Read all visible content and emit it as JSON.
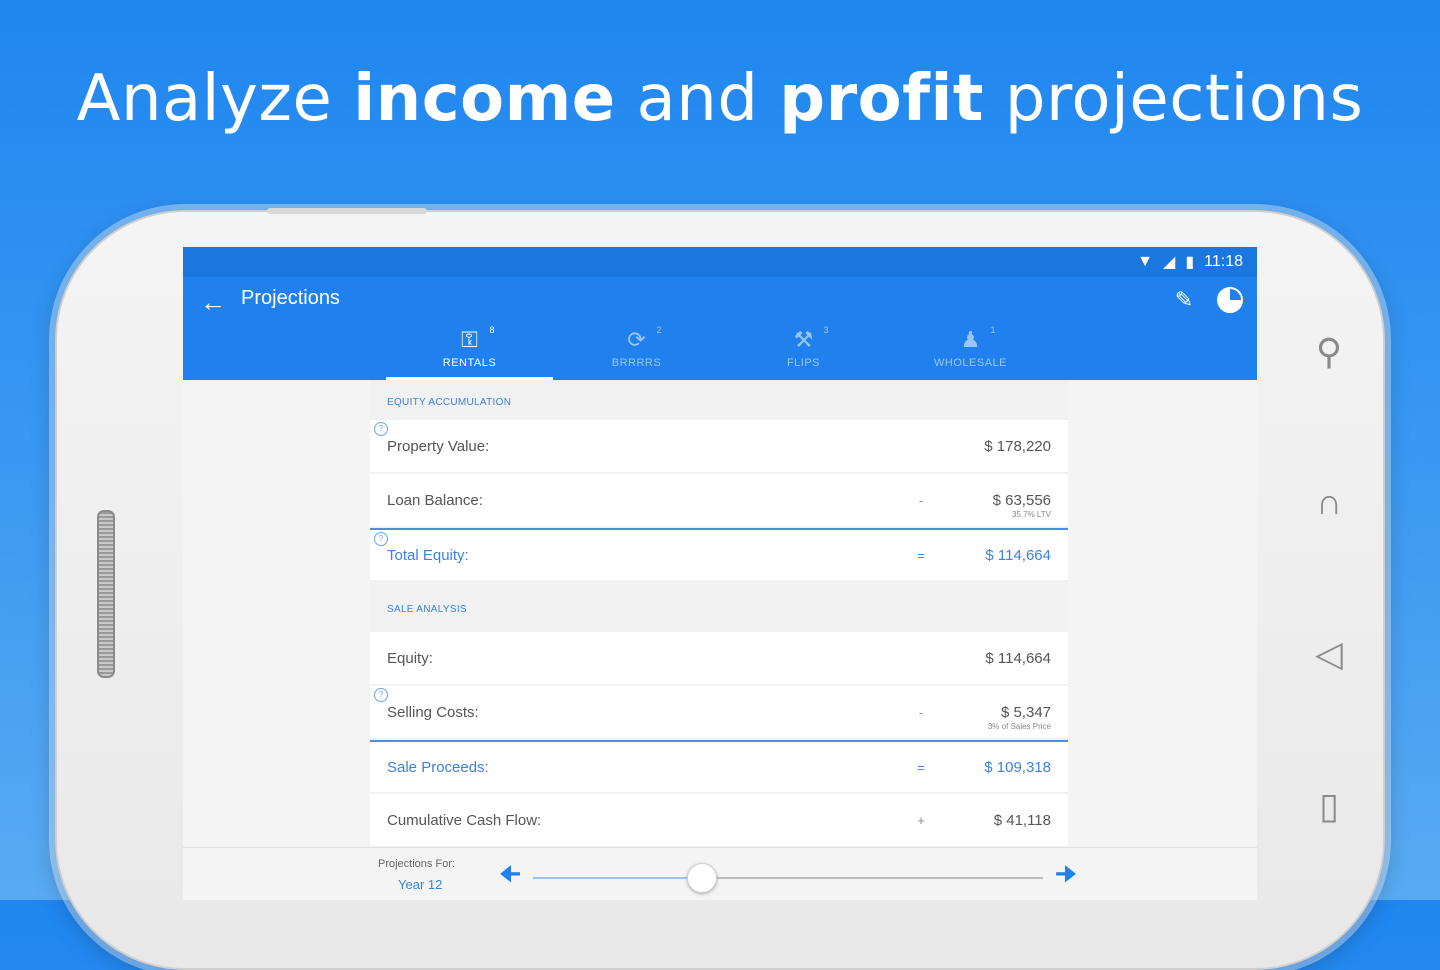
{
  "headline": {
    "part1": "Analyze ",
    "bold1": "income",
    "part2": " and ",
    "bold2": "profit",
    "part3": " projections"
  },
  "status": {
    "time": "11:18"
  },
  "appbar": {
    "title": "Projections"
  },
  "tabs": [
    {
      "label": "RENTALS",
      "count": "8",
      "icon": "key-icon",
      "active": true
    },
    {
      "label": "BRRRRS",
      "count": "2",
      "icon": "refresh-icon",
      "active": false
    },
    {
      "label": "FLIPS",
      "count": "3",
      "icon": "tools-icon",
      "active": false
    },
    {
      "label": "WHOLESALE",
      "count": "1",
      "icon": "people-icon",
      "active": false
    }
  ],
  "equity": {
    "header": "EQUITY ACCUMULATION",
    "property_value": {
      "label": "Property Value:",
      "value": "$ 178,220"
    },
    "loan_balance": {
      "label": "Loan Balance:",
      "op": "-",
      "value": "$ 63,556",
      "sub": "35.7% LTV"
    },
    "total_equity": {
      "label": "Total Equity:",
      "op": "=",
      "value": "$ 114,664"
    }
  },
  "sale": {
    "header": "SALE ANALYSIS",
    "equity": {
      "label": "Equity:",
      "value": "$ 114,664"
    },
    "selling_costs": {
      "label": "Selling Costs:",
      "op": "-",
      "value": "$ 5,347",
      "sub": "3% of Sales Price"
    },
    "sale_proceeds": {
      "label": "Sale Proceeds:",
      "op": "=",
      "value": "$ 109,318"
    },
    "cumulative_cash_flow": {
      "label": "Cumulative Cash Flow:",
      "op": "+",
      "value": "$ 41,118"
    }
  },
  "projection": {
    "label": "Projections For:",
    "year": "Year 12",
    "slider_fraction": 0.33
  },
  "colors": {
    "primary": "#1f80ee",
    "accent": "#3a82e0",
    "background_blue": "#2b8ff1"
  }
}
